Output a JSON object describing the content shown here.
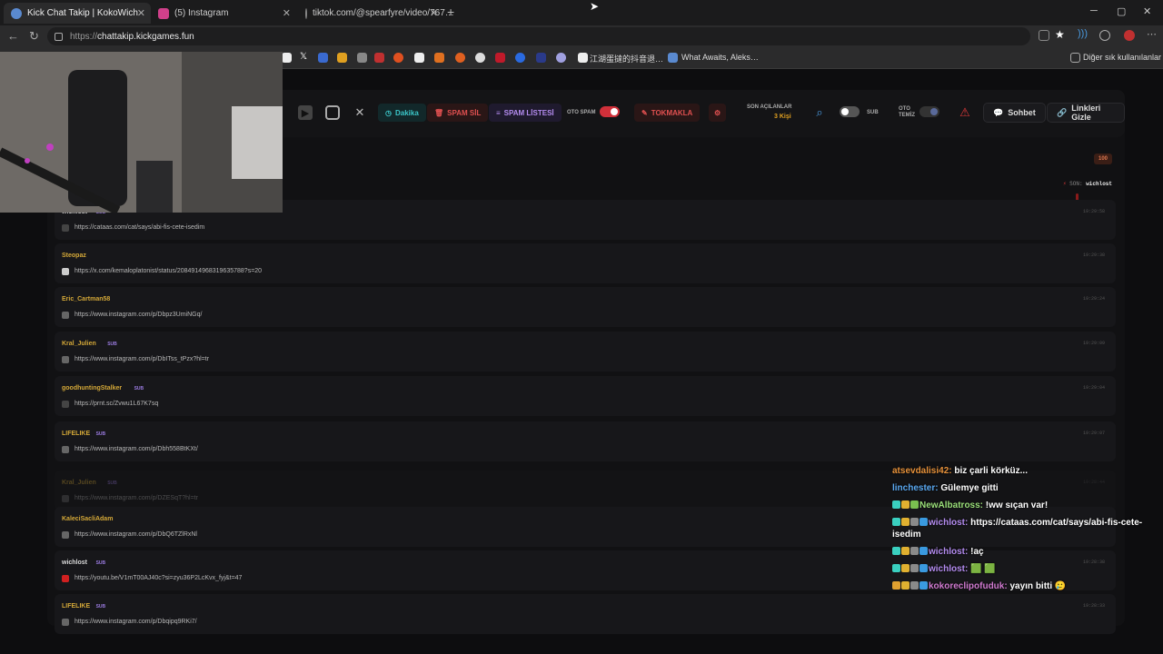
{
  "browser": {
    "tabs": [
      {
        "title": "Kick Chat Takip | KokoWich",
        "active": true
      },
      {
        "title": "(5) Instagram",
        "active": false
      },
      {
        "title": "tiktok.com/@spearfyre/video/767…",
        "active": false
      }
    ],
    "new_tab": "+",
    "window_controls": {
      "minimize": "─",
      "maximize": "▢",
      "close": "✕"
    },
    "url_scheme": "https://",
    "url_host": "chattakip.kickgames.fun",
    "bookmarks": [
      {
        "label": "江湖蛋撻的抖音退…"
      },
      {
        "label": "What Awaits, Aleks…"
      }
    ],
    "other_bookmarks": "Diğer sık kullanılanlar"
  },
  "toolbar": {
    "dakika": "Dakika",
    "spam_sil": "SPAM SİL",
    "spam_listesi": "SPAM LİSTESİ",
    "oto_spam": "OTO SPAM",
    "tokmakla": "TOKMAKLA",
    "son_acilanlar": "SON AÇILANLAR",
    "kisi": "3 Kişi",
    "sub_label": "SUB",
    "oto_temiz_1": "OTO",
    "oto_temiz_2": "TEMİZ",
    "sohbet": "Sohbet",
    "linkleri_gizle": "Linkleri Gizle"
  },
  "counter": {
    "value": "100",
    "last_prefix": "SON:",
    "last_user": "wichlost"
  },
  "links": [
    {
      "user": "wichlost",
      "sub": true,
      "link": "https://cataas.com/cat/says/abi-fis-cete-isedim",
      "time": "19:29:58",
      "user_color": "#d9d9d9",
      "icon": "link"
    },
    {
      "user": "Steopaz",
      "sub": false,
      "link": "https://x.com/kemaloplatonist/status/2084914968319635788?s=20",
      "time": "19:29:38",
      "user_color": "#d4a838",
      "icon": "x"
    },
    {
      "user": "Eric_Cartman58",
      "sub": false,
      "link": "https://www.instagram.com/p/Dbpz3UmiNGq/",
      "time": "19:29:24",
      "user_color": "#d4a838",
      "icon": "instagram"
    },
    {
      "user": "Kral_Julien",
      "sub": true,
      "link": "https://www.instagram.com/p/DbITss_tPzx?hl=tr",
      "time": "19:29:09",
      "user_color": "#d4a838",
      "icon": "instagram"
    },
    {
      "user": "goodhuntingStalker",
      "sub": true,
      "link": "https://prnt.sc/Zvwu1L67K7sq",
      "time": "19:29:04",
      "user_color": "#d4a838",
      "icon": "link"
    },
    {
      "user": "LIFELIKE",
      "sub": true,
      "link": "https://www.instagram.com/p/Dbh558BtKXt/",
      "time": "19:29:07",
      "user_color": "#d4a838",
      "icon": "instagram"
    },
    {
      "user": "Kral_Julien",
      "sub": true,
      "link": "https://www.instagram.com/p/DZESqT?hl=tr",
      "time": "19:28:44",
      "user_color": "#d4a838",
      "icon": "instagram"
    },
    {
      "user": "KaleciSacliAdam",
      "sub": false,
      "link": "https://www.instagram.com/p/DbQ6TZlRxNl",
      "time": "",
      "user_color": "#d4a838",
      "icon": "instagram"
    },
    {
      "user": "wichlost",
      "sub": true,
      "link": "https://youtu.be/V1mT00AJ40c?si=zyu36P2LcKvx_fyj&t=47",
      "time": "19:28:38",
      "user_color": "#d9d9d9",
      "icon": "youtube"
    },
    {
      "user": "LIFELIKE",
      "sub": true,
      "link": "https://www.instagram.com/p/Dbqipq9RKi7/",
      "time": "19:28:33",
      "user_color": "#d4a838",
      "icon": "instagram"
    }
  ],
  "sub_tag": "SUB",
  "chat": [
    {
      "user": "atsevdalisi42:",
      "msg": "biz çarli körküz...",
      "color": "#e6913a",
      "badges": []
    },
    {
      "user": "linchester:",
      "msg": "Gülemye gitti",
      "color": "#5aa8f0",
      "badges": []
    },
    {
      "user": "NewAlbatross:",
      "msg": "!ww sıçan var!",
      "color": "#9be07a",
      "badges": [
        "#3ad0c0",
        "#e0b030",
        "#7ac050"
      ]
    },
    {
      "user": "wichlost:",
      "msg": "https://cataas.com/cat/says/abi-fis-cete-isedim",
      "color": "#b48cf0",
      "badges": [
        "#3ad0c0",
        "#e0b030",
        "#8a8a8a",
        "#3a9ae0"
      ]
    },
    {
      "user": "wichlost:",
      "msg": "!aç",
      "color": "#b48cf0",
      "badges": [
        "#3ad0c0",
        "#e0b030",
        "#8a8a8a",
        "#3a9ae0"
      ]
    },
    {
      "user": "wichlost:",
      "msg": "🟩 🟩",
      "color": "#b48cf0",
      "badges": [
        "#3ad0c0",
        "#e0b030",
        "#8a8a8a",
        "#3a9ae0"
      ]
    },
    {
      "user": "kokoreclipofuduk:",
      "msg": "yayın bitti 🥲",
      "color": "#d07ad0",
      "badges": [
        "#e0a030",
        "#e0b030",
        "#8a8a8a",
        "#3a9ae0"
      ]
    }
  ]
}
